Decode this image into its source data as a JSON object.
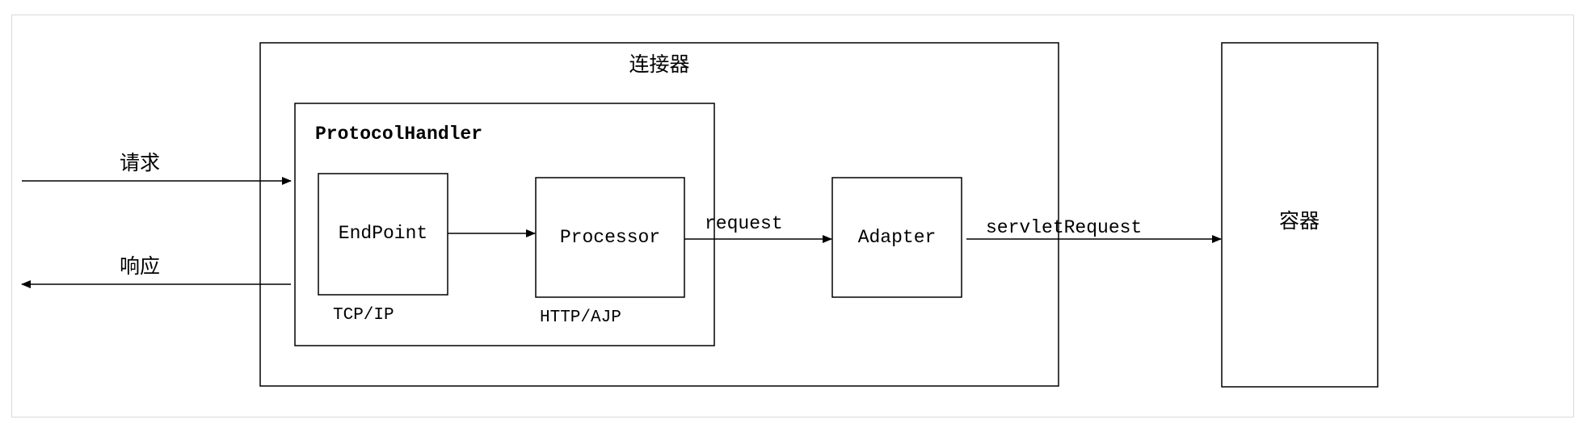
{
  "connector": {
    "label": "连接器"
  },
  "protocol_handler": {
    "label": "ProtocolHandler"
  },
  "endpoint": {
    "label": "EndPoint",
    "caption": "TCP/IP"
  },
  "processor": {
    "label": "Processor",
    "caption": "HTTP/AJP"
  },
  "adapter": {
    "label": "Adapter"
  },
  "container": {
    "label": "容器"
  },
  "arrows": {
    "request_in": "请求",
    "response_out": "响应",
    "request": "request",
    "servlet_request": "servletRequest"
  },
  "colors": {
    "stroke": "#000000",
    "frame": "#d9d9d9",
    "background": "#ffffff"
  }
}
